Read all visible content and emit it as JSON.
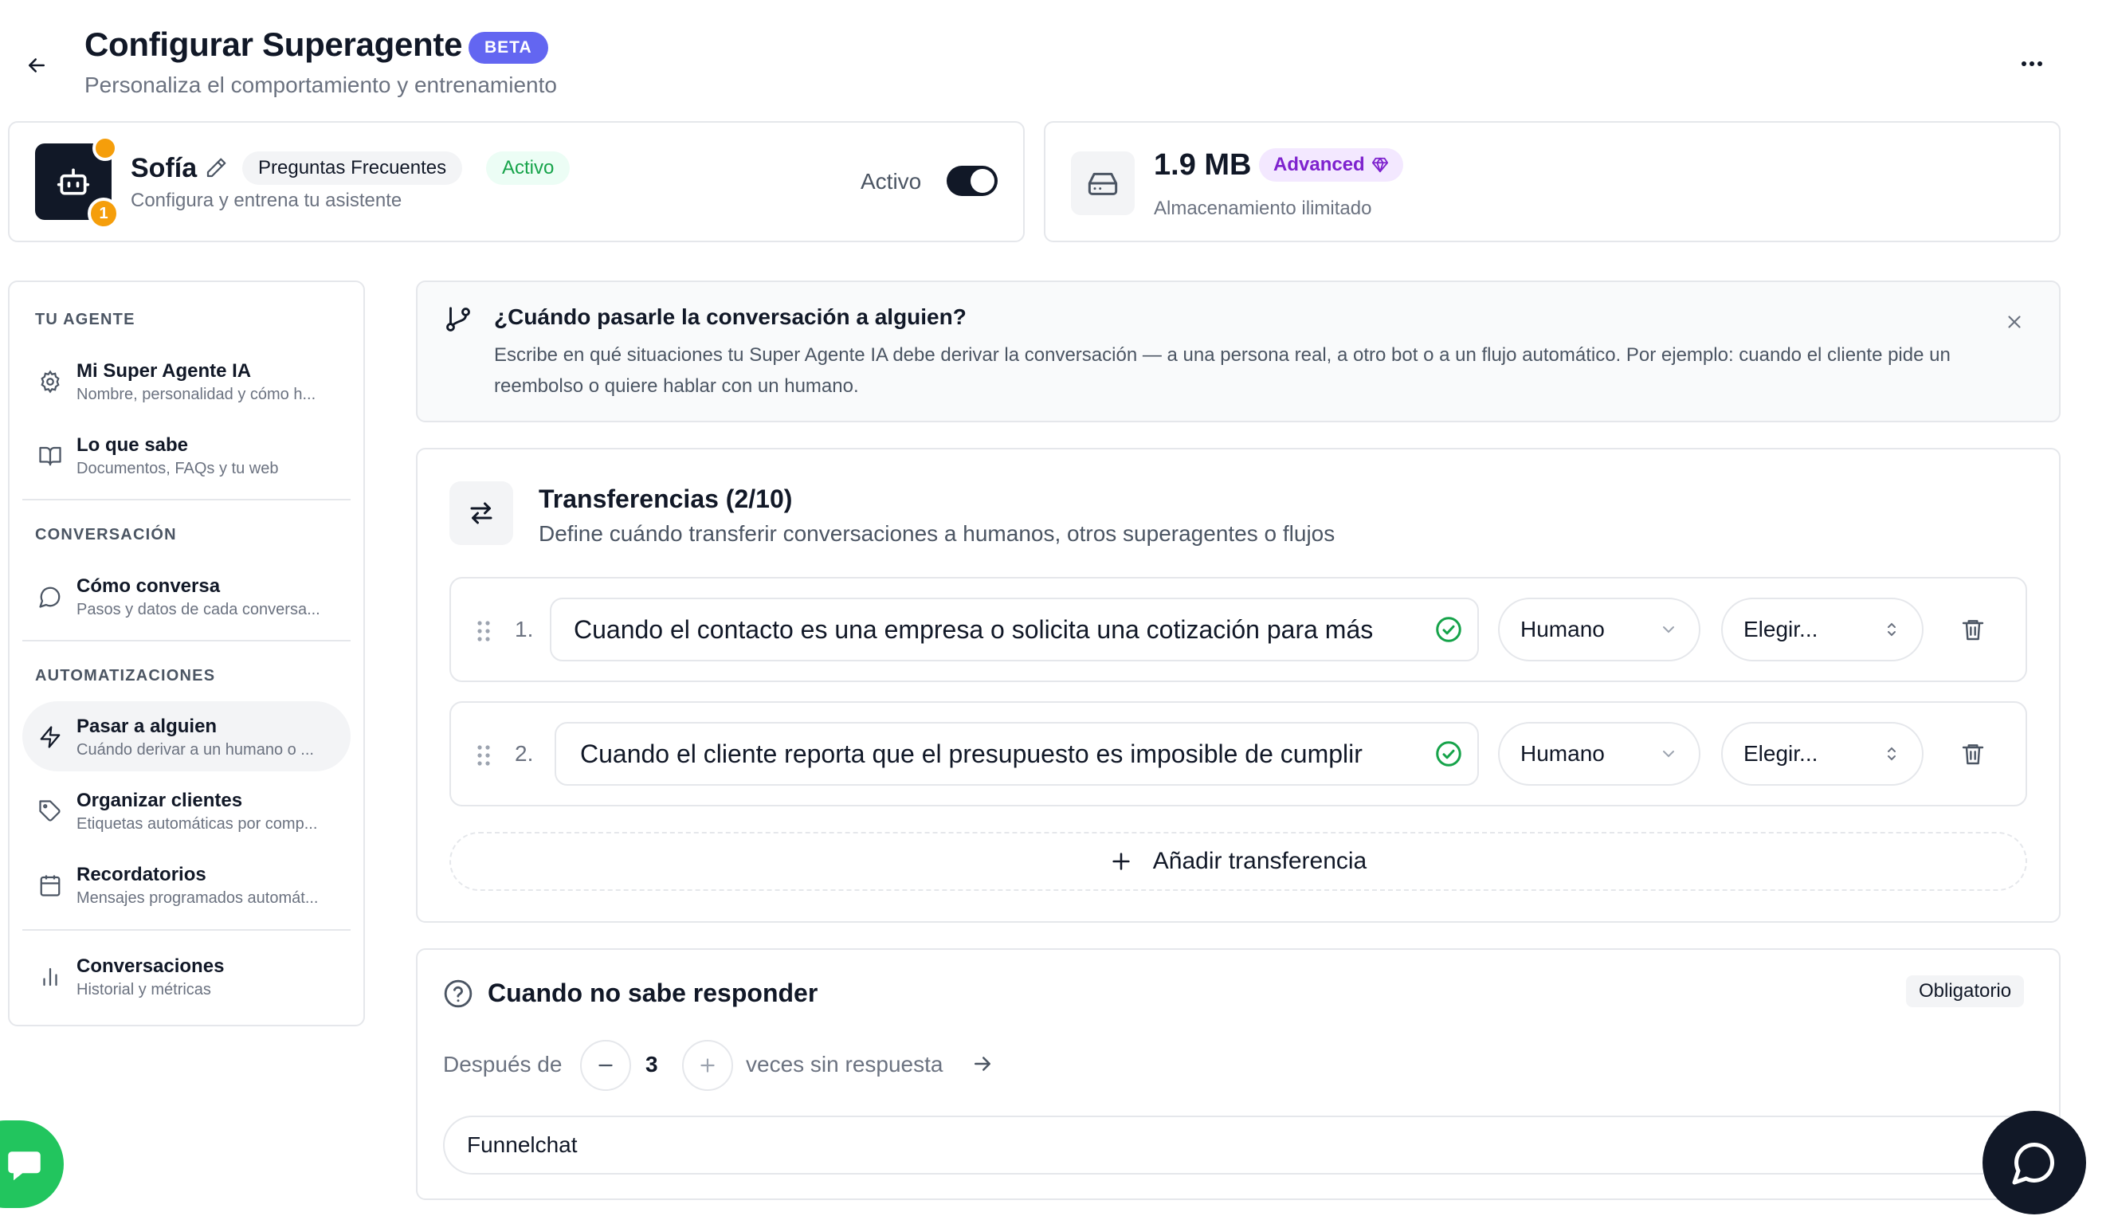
{
  "header": {
    "title": "Configurar Superagente",
    "badge": "BETA",
    "subtitle": "Personaliza el comportamiento y entrenamiento"
  },
  "agent": {
    "name": "Sofía",
    "tag": "Preguntas Frecuentes",
    "status": "Activo",
    "subtitle": "Configura y entrena tu asistente",
    "toggle_label": "Activo",
    "toggle_on": true,
    "notification_count": "1"
  },
  "storage": {
    "size": "1.9 MB",
    "plan": "Advanced",
    "subtitle": "Almacenamiento ilimitado"
  },
  "sidebar": {
    "sections": [
      {
        "label": "TU AGENTE",
        "items": [
          {
            "title": "Mi Super Agente IA",
            "subtitle": "Nombre, personalidad y cómo h...",
            "icon": "gear-icon"
          },
          {
            "title": "Lo que sabe",
            "subtitle": "Documentos, FAQs y tu web",
            "icon": "book-icon"
          }
        ]
      },
      {
        "label": "CONVERSACIÓN",
        "items": [
          {
            "title": "Cómo conversa",
            "subtitle": "Pasos y datos de cada conversa...",
            "icon": "chat-bubble-icon"
          }
        ]
      },
      {
        "label": "AUTOMATIZACIONES",
        "items": [
          {
            "title": "Pasar a alguien",
            "subtitle": "Cuándo derivar a un humano o ...",
            "icon": "lightning-icon",
            "active": true
          },
          {
            "title": "Organizar clientes",
            "subtitle": "Etiquetas automáticas por comp...",
            "icon": "tag-icon"
          },
          {
            "title": "Recordatorios",
            "subtitle": "Mensajes programados automát...",
            "icon": "calendar-icon"
          }
        ]
      },
      {
        "label": "",
        "items": [
          {
            "title": "Conversaciones",
            "subtitle": "Historial y métricas",
            "icon": "bar-chart-icon"
          }
        ]
      }
    ]
  },
  "banner": {
    "title": "¿Cuándo pasarle la conversación a alguien?",
    "text": "Escribe en qué situaciones tu Super Agente IA debe derivar la conversación — a una persona real, a otro bot o a un flujo automático. Por ejemplo: cuando el cliente pide un reembolso o quiere hablar con un humano."
  },
  "transfers": {
    "title": "Transferencias (2/10)",
    "subtitle": "Define cuándo transferir conversaciones a humanos, otros superagentes o flujos",
    "rules": [
      {
        "number": "1.",
        "text": "Cuando el contacto es una empresa o solicita una cotización para más",
        "type": "Humano",
        "target": "Elegir..."
      },
      {
        "number": "2.",
        "text": "Cuando el cliente reporta que el presupuesto es imposible de cumplir",
        "type": "Humano",
        "target": "Elegir..."
      }
    ],
    "add_label": "Añadir transferencia"
  },
  "fallback": {
    "title": "Cuando no sabe responder",
    "badge": "Obligatorio",
    "after_label": "Después de",
    "count": "3",
    "times_label": "veces sin respuesta",
    "destination": "Funnelchat"
  },
  "colors": {
    "accent": "#6366f1",
    "dark": "#111827",
    "green": "#16a34a",
    "purple": "#7e22ce",
    "orange": "#f59e0b"
  }
}
